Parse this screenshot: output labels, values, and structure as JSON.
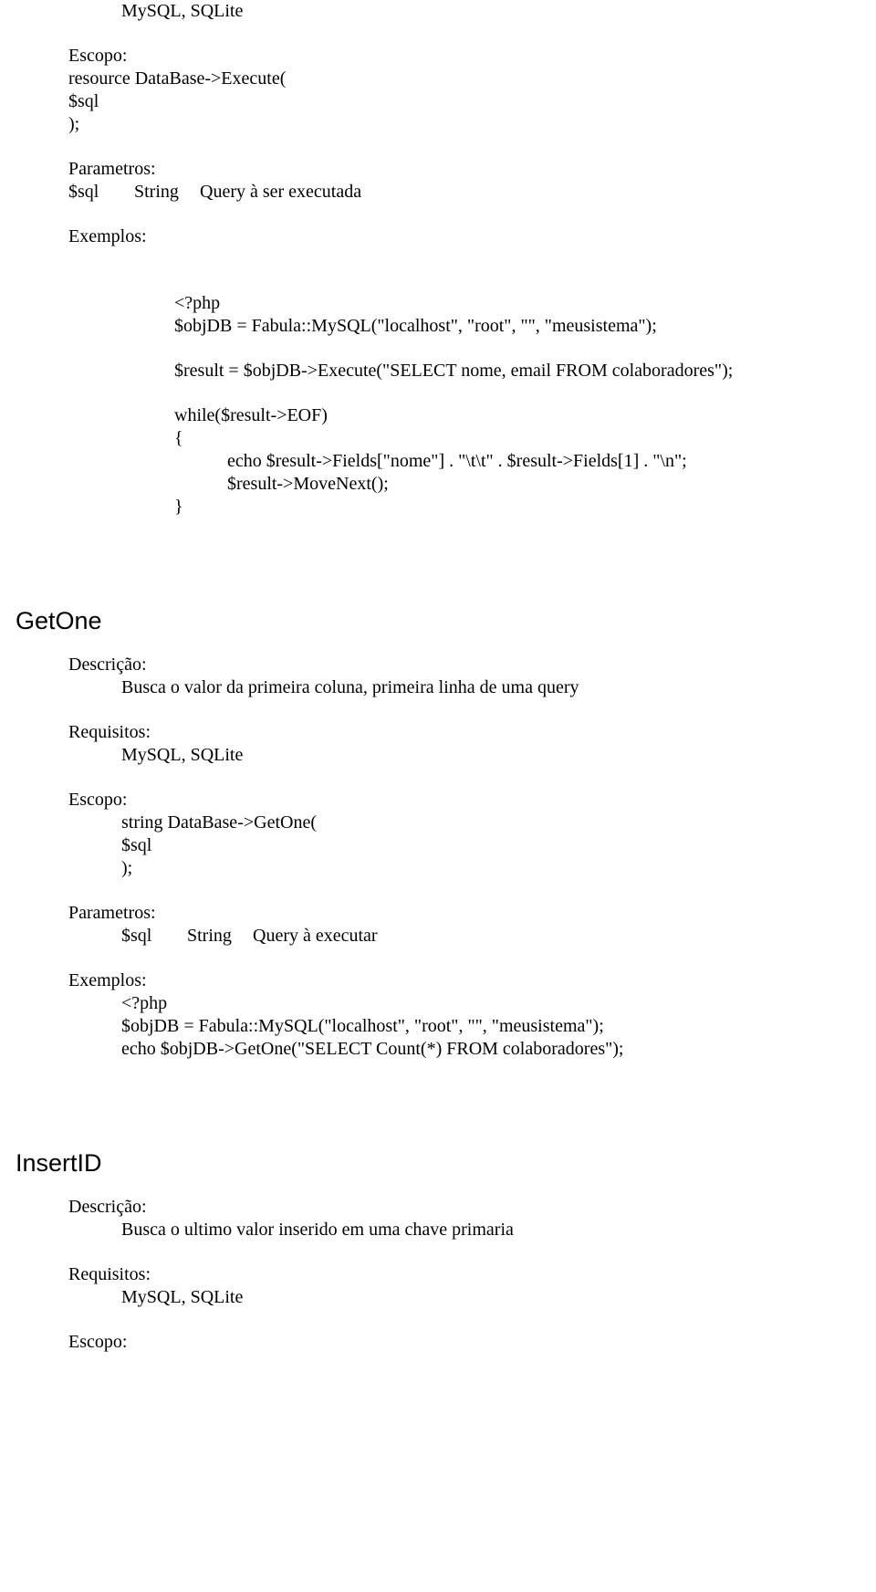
{
  "execute_prev": {
    "requisitos_value": "MySQL, SQLite",
    "escopo_label": "Escopo:",
    "escopo_line1": "resource DataBase->Execute(",
    "escopo_line2": "$sql",
    "escopo_line3": ");",
    "parametros_label": "Parametros:",
    "param_col1": "$sql",
    "param_col2": "String",
    "param_col3": "Query à ser executada",
    "exemplos_label": "Exemplos:",
    "code": {
      "l1": "<?php",
      "l2": "$objDB = Fabula::MySQL(\"localhost\", \"root\", \"\", \"meusistema\");",
      "l3": "$result = $objDB->Execute(\"SELECT nome, email FROM colaboradores\");",
      "l4": "while($result->EOF)",
      "l5": "{",
      "l6": "echo $result->Fields[\"nome\"] . \"\\t\\t\" . $result->Fields[1] . \"\\n\";",
      "l7": "$result->MoveNext();",
      "l8": "}"
    }
  },
  "getone": {
    "title": "GetOne",
    "descricao_label": "Descrição:",
    "descricao_value": "Busca o valor da primeira coluna, primeira linha de uma query",
    "requisitos_label": "Requisitos:",
    "requisitos_value": "MySQL, SQLite",
    "escopo_label": "Escopo:",
    "escopo_line1": "string DataBase->GetOne(",
    "escopo_line2": "$sql",
    "escopo_line3": ");",
    "parametros_label": "Parametros:",
    "param_col1": "$sql",
    "param_col2": "String",
    "param_col3": "Query à executar",
    "exemplos_label": "Exemplos:",
    "code": {
      "l1": "<?php",
      "l2": "$objDB = Fabula::MySQL(\"localhost\", \"root\", \"\", \"meusistema\");",
      "l3": "echo $objDB->GetOne(\"SELECT Count(*) FROM colaboradores\");"
    }
  },
  "insertid": {
    "title": "InsertID",
    "descricao_label": "Descrição:",
    "descricao_value": "Busca o ultimo valor inserido em uma chave primaria",
    "requisitos_label": "Requisitos:",
    "requisitos_value": "MySQL, SQLite",
    "escopo_label": "Escopo:"
  }
}
